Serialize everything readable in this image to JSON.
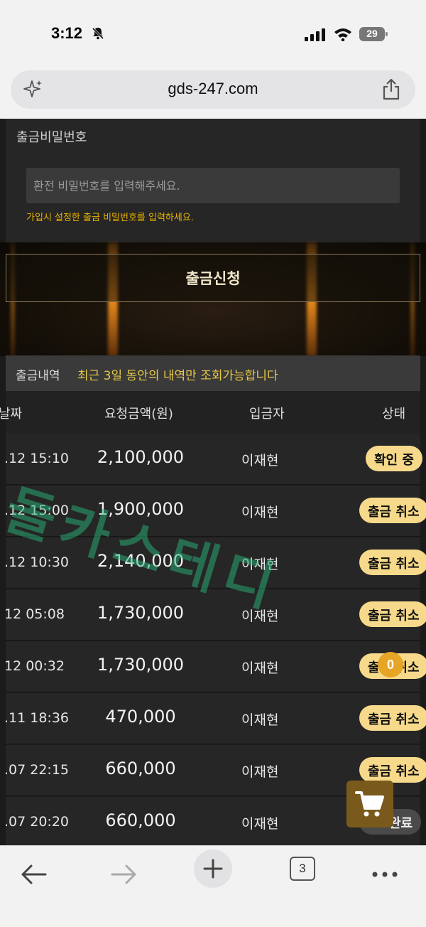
{
  "status": {
    "time": "3:12",
    "battery": "29"
  },
  "browser": {
    "url": "gds-247.com",
    "tabs_count": "3"
  },
  "password": {
    "label": "출금비밀번호",
    "placeholder": "환전 비밀번호를 입력해주세요.",
    "hint": "가입시 설정한 출금 비밀번호를 입력하세요."
  },
  "submit": {
    "label": "출금신청"
  },
  "history": {
    "title": "출금내역",
    "note": "최근 3일 동안의 내역만 조회가능합니다",
    "columns": {
      "date": "날짜",
      "amount": "요청금액(원)",
      "depositor": "입금자",
      "status": "상태"
    },
    "rows": [
      {
        "date": ".12 15:10",
        "amount": "2,100,000",
        "depositor": "이재현",
        "status": "확인 중"
      },
      {
        "date": ".12 15:00",
        "amount": "1,900,000",
        "depositor": "이재현",
        "status": "출금 취소"
      },
      {
        "date": ".12 10:30",
        "amount": "2,140,000",
        "depositor": "이재현",
        "status": "출금 취소"
      },
      {
        "date": "12 05:08",
        "amount": "1,730,000",
        "depositor": "이재현",
        "status": "출금 취소"
      },
      {
        "date": "12 00:32",
        "amount": "1,730,000",
        "depositor": "이재현",
        "status": "출금 취소"
      },
      {
        "date": ".11 18:36",
        "amount": "470,000",
        "depositor": "이재현",
        "status": "출금 취소"
      },
      {
        "date": ".07 22:15",
        "amount": "660,000",
        "depositor": "이재현",
        "status": "출금 취소"
      },
      {
        "date": ".07 20:20",
        "amount": "660,000",
        "depositor": "이재현",
        "status": "완료"
      }
    ]
  },
  "watermark": {
    "text": "돌카스테디"
  },
  "cart": {
    "count": "0"
  }
}
